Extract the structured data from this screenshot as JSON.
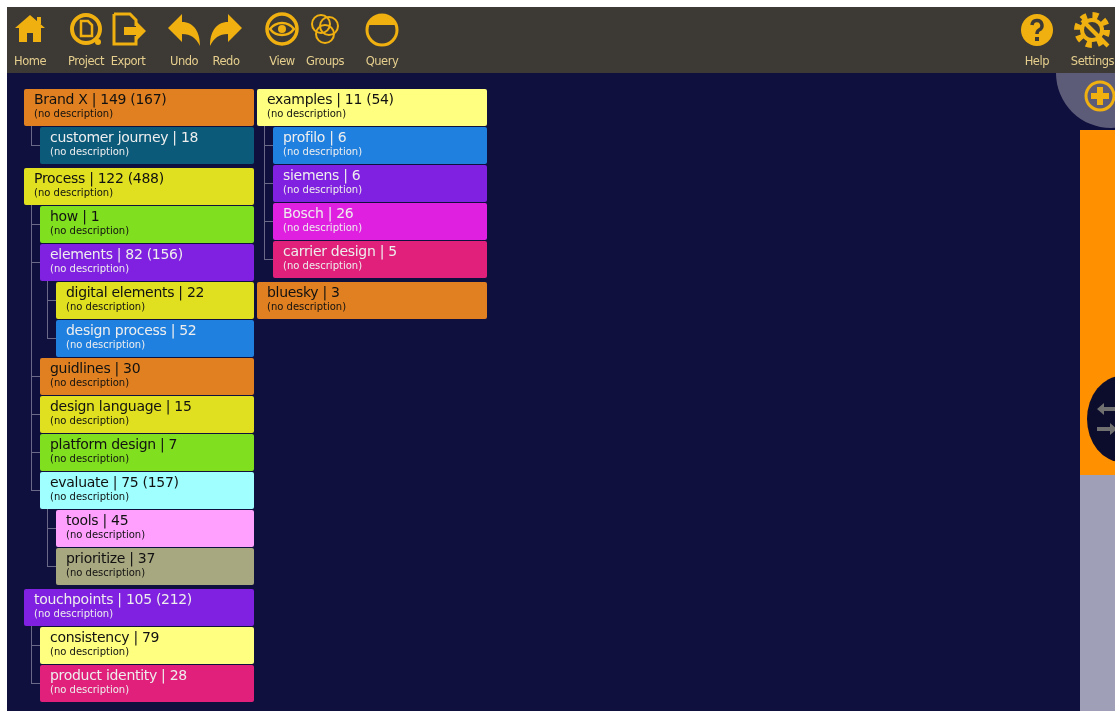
{
  "toolbar": {
    "left_groups": [
      [
        {
          "label": "Home"
        }
      ],
      [
        {
          "label": "Project"
        },
        {
          "label": "Export"
        }
      ],
      [
        {
          "label": "Undo"
        },
        {
          "label": "Redo"
        }
      ],
      [
        {
          "label": "View"
        },
        {
          "label": "Groups"
        }
      ],
      [
        {
          "label": "Query"
        }
      ]
    ],
    "right": [
      {
        "label": "Help"
      },
      {
        "label": "Settings"
      }
    ]
  },
  "tree": {
    "columns": [
      [
        {
          "title": "Brand X | 149 (167)",
          "description": "(no description)",
          "color": "#e08020",
          "children": [
            {
              "title": "customer journey | 18",
              "description": "(no description)",
              "color": "#0b5a7a"
            }
          ]
        },
        {
          "title": "Process | 122 (488)",
          "description": "(no description)",
          "color": "#e0e020",
          "children": [
            {
              "title": "how | 1",
              "description": "(no description)",
              "color": "#80e020"
            },
            {
              "title": "elements | 82 (156)",
              "description": "(no description)",
              "color": "#8020e0",
              "children": [
                {
                  "title": "digital elements | 22",
                  "description": "(no description)",
                  "color": "#e0e020"
                },
                {
                  "title": "design process | 52",
                  "description": "(no description)",
                  "color": "#2080e0"
                }
              ]
            },
            {
              "title": "guidlines | 30",
              "description": "(no description)",
              "color": "#e08020"
            },
            {
              "title": "design language | 15",
              "description": "(no description)",
              "color": "#e0e020"
            },
            {
              "title": "platform design | 7",
              "description": "(no description)",
              "color": "#80e020"
            },
            {
              "title": "evaluate | 75 (157)",
              "description": "(no description)",
              "color": "#a0ffff",
              "children": [
                {
                  "title": "tools | 45",
                  "description": "(no description)",
                  "color": "#ffa0ff"
                },
                {
                  "title": "prioritize | 37",
                  "description": "(no description)",
                  "color": "#a8a880"
                }
              ]
            }
          ]
        },
        {
          "title": "touchpoints | 105 (212)",
          "description": "(no description)",
          "color": "#8020e0",
          "children": [
            {
              "title": "consistency | 79",
              "description": "(no description)",
              "color": "#ffff80"
            },
            {
              "title": "product identity | 28",
              "description": "(no description)",
              "color": "#e0207a"
            }
          ]
        }
      ],
      [
        {
          "title": "examples | 11 (54)",
          "description": "(no description)",
          "color": "#ffff80",
          "children": [
            {
              "title": "profilo | 6",
              "description": "(no description)",
              "color": "#2080e0"
            },
            {
              "title": "siemens | 6",
              "description": "(no description)",
              "color": "#8020e0"
            },
            {
              "title": "Bosch | 26",
              "description": "(no description)",
              "color": "#e020e0"
            },
            {
              "title": "carrier design | 5",
              "description": "(no description)",
              "color": "#e0207a"
            }
          ]
        },
        {
          "title": "bluesky | 3",
          "description": "(no description)",
          "color": "#e08020"
        }
      ]
    ]
  }
}
